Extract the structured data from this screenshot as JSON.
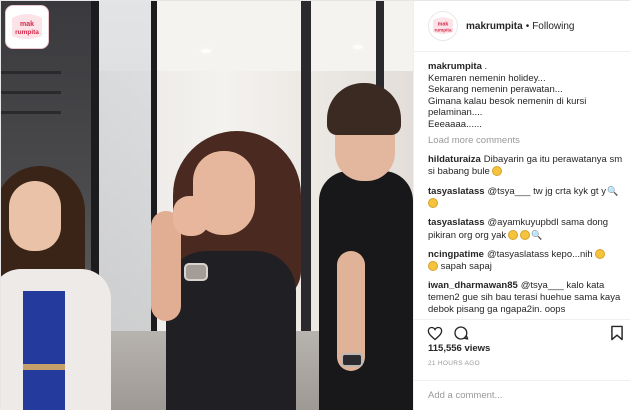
{
  "header": {
    "username": "makrumpita",
    "separator": "•",
    "follow_status": "Following"
  },
  "brand_logo": {
    "text": "mak rumpita",
    "color": "#d42a4b"
  },
  "caption": {
    "username": "makrumpita",
    "first_word": ".",
    "lines": [
      "Kemaren nemenin holidey...",
      "Sekarang nemenin perawatan...",
      "Gimana kalau besok nemenin di kursi",
      "pelaminan....",
      "Eeeaaaa......"
    ]
  },
  "load_more": "Load more comments",
  "comments": [
    {
      "user": "hildaturaiza",
      "text": "Dibayarin ga itu perawatanya sm si babang bule",
      "emoji": [
        "grin"
      ]
    },
    {
      "user": "tasyaslatass",
      "text": "@tsya___ tw jg crta kyk gt y",
      "emoji": [
        "magnifier",
        "grin"
      ]
    },
    {
      "user": "tasyaslatass",
      "text": "@ayamkuyupbdl sama dong pikiran org org yak",
      "emoji": [
        "grin",
        "grin",
        "magnifier"
      ]
    },
    {
      "user": "ncingpatime",
      "text": "@tasyaslatass kepo...nih",
      "tail": "sapah sapaj",
      "emoji": [
        "grin",
        "grin"
      ]
    },
    {
      "user": "iwan_dharmawan85",
      "text": "@tsya___ kalo kata temen2 gue sih bau terasi huehue sama kaya debok pisang ga ngapa2in. oops",
      "emoji": []
    }
  ],
  "actions": {
    "like_icon": "heart-icon",
    "comment_icon": "comment-bubble-icon",
    "save_icon": "bookmark-icon"
  },
  "views": "115,556 views",
  "timestamp": "21 HOURS AGO",
  "add_comment_placeholder": "Add a comment...",
  "colors": {
    "accent": "#d42a4b",
    "muted": "#999999",
    "text": "#262626"
  }
}
